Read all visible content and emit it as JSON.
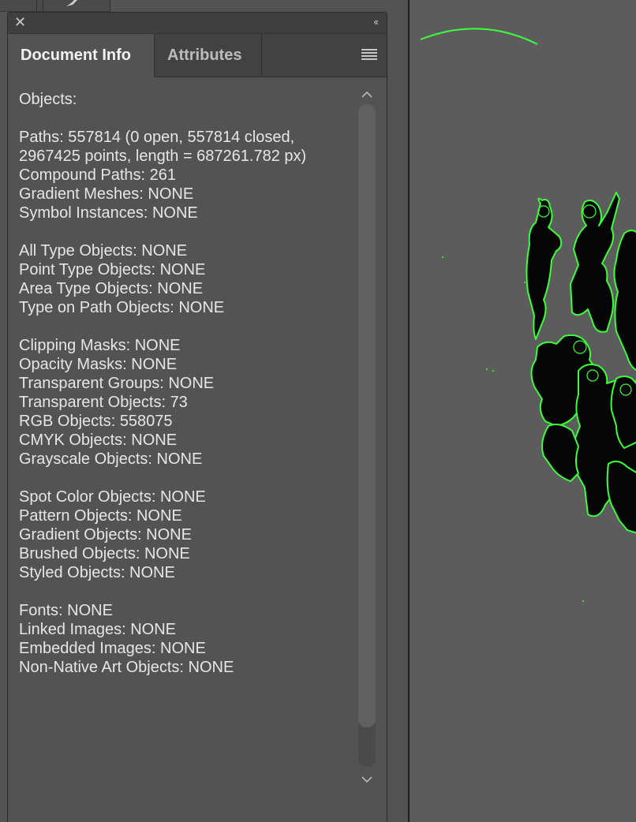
{
  "panel": {
    "tabs": [
      {
        "label": "Document Info",
        "active": true
      },
      {
        "label": "Attributes",
        "active": false
      }
    ],
    "close_glyph": "✕",
    "collapse_glyph": "‹‹"
  },
  "info_lines": [
    "Objects:",
    "",
    "Paths: 557814 (0 open, 557814 closed,",
    "2967425 points, length = 687261.782 px)",
    "Compound Paths: 261",
    "Gradient Meshes: NONE",
    "Symbol Instances: NONE",
    "",
    "All Type Objects: NONE",
    "Point Type Objects: NONE",
    "Area Type Objects: NONE",
    "Type on Path Objects: NONE",
    "",
    "Clipping Masks: NONE",
    "Opacity Masks: NONE",
    "Transparent Groups: NONE",
    "Transparent Objects: 73",
    "RGB Objects: 558075",
    "CMYK Objects: NONE",
    "Grayscale Objects: NONE",
    "",
    "Spot Color Objects: NONE",
    "Pattern Objects: NONE",
    "Gradient Objects: NONE",
    "Brushed Objects: NONE",
    "Styled Objects: NONE",
    "",
    "Fonts: NONE",
    "Linked Images: NONE",
    "Embedded Images: NONE",
    "Non-Native Art Objects: NONE"
  ],
  "icons": {
    "close": "close-icon",
    "collapse": "double-chevron-left-icon",
    "menu": "hamburger-menu-icon",
    "scroll_up": "chevron-up-icon",
    "scroll_down": "chevron-down-icon",
    "brush": "brush-icon"
  },
  "colors": {
    "panel_bg": "#535353",
    "tab_bar_bg": "#424242",
    "text": "#e6e6e6",
    "selection_outline": "#3dff3d",
    "canvas_bg": "#5c5c5c"
  }
}
